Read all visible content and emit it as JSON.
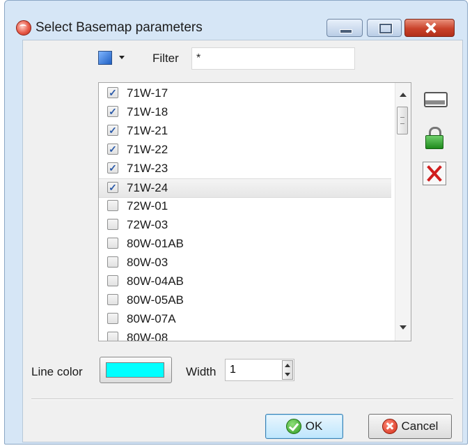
{
  "window": {
    "title": "Select Basemap parameters"
  },
  "toolbar": {
    "filter_label": "Filter",
    "filter_value": "*"
  },
  "list": {
    "items": [
      {
        "label": "71W-17",
        "checked": true
      },
      {
        "label": "71W-18",
        "checked": true
      },
      {
        "label": "71W-21",
        "checked": true
      },
      {
        "label": "71W-22",
        "checked": true
      },
      {
        "label": "71W-23",
        "checked": true
      },
      {
        "label": "71W-24",
        "checked": true,
        "selected": true
      },
      {
        "label": "72W-01",
        "checked": false
      },
      {
        "label": "72W-03",
        "checked": false
      },
      {
        "label": "80W-01AB",
        "checked": false
      },
      {
        "label": "80W-03",
        "checked": false
      },
      {
        "label": "80W-04AB",
        "checked": false
      },
      {
        "label": "80W-05AB",
        "checked": false
      },
      {
        "label": "80W-07A",
        "checked": false
      },
      {
        "label": "80W-08",
        "checked": false
      }
    ]
  },
  "line": {
    "color_label": "Line color",
    "color": "#00ffff",
    "width_label": "Width",
    "width_value": "1"
  },
  "buttons": {
    "ok": "OK",
    "cancel": "Cancel"
  },
  "icons": {
    "app": "globe-icon",
    "minimize": "minimize-icon",
    "maximize": "maximize-icon",
    "close": "close-icon",
    "color_picker": "color-swatch-icon",
    "rename": "rename-icon",
    "lock": "lock-icon",
    "delete": "delete-icon",
    "ok": "check-circle-icon",
    "cancel": "cancel-circle-icon"
  },
  "colors": {
    "title_bg": "#d6e6f6",
    "dialog_bg": "#f0f0f0",
    "close_red": "#c9422a",
    "check_blue": "#2b5aa8"
  }
}
